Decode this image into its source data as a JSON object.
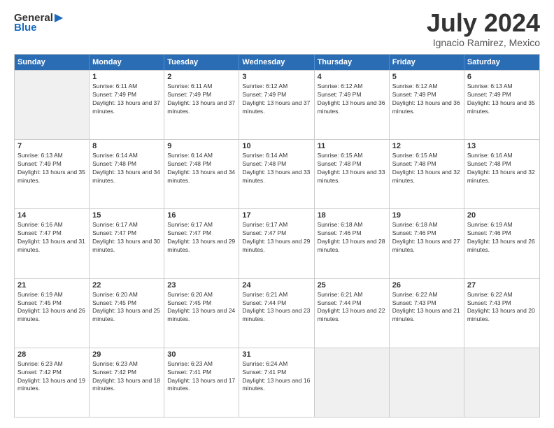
{
  "header": {
    "logo_general": "General",
    "logo_blue": "Blue",
    "title": "July 2024",
    "location": "Ignacio Ramirez, Mexico"
  },
  "calendar": {
    "weekdays": [
      "Sunday",
      "Monday",
      "Tuesday",
      "Wednesday",
      "Thursday",
      "Friday",
      "Saturday"
    ],
    "weeks": [
      [
        {
          "day": "",
          "sunrise": "",
          "sunset": "",
          "daylight": ""
        },
        {
          "day": "1",
          "sunrise": "Sunrise: 6:11 AM",
          "sunset": "Sunset: 7:49 PM",
          "daylight": "Daylight: 13 hours and 37 minutes."
        },
        {
          "day": "2",
          "sunrise": "Sunrise: 6:11 AM",
          "sunset": "Sunset: 7:49 PM",
          "daylight": "Daylight: 13 hours and 37 minutes."
        },
        {
          "day": "3",
          "sunrise": "Sunrise: 6:12 AM",
          "sunset": "Sunset: 7:49 PM",
          "daylight": "Daylight: 13 hours and 37 minutes."
        },
        {
          "day": "4",
          "sunrise": "Sunrise: 6:12 AM",
          "sunset": "Sunset: 7:49 PM",
          "daylight": "Daylight: 13 hours and 36 minutes."
        },
        {
          "day": "5",
          "sunrise": "Sunrise: 6:12 AM",
          "sunset": "Sunset: 7:49 PM",
          "daylight": "Daylight: 13 hours and 36 minutes."
        },
        {
          "day": "6",
          "sunrise": "Sunrise: 6:13 AM",
          "sunset": "Sunset: 7:49 PM",
          "daylight": "Daylight: 13 hours and 35 minutes."
        }
      ],
      [
        {
          "day": "7",
          "sunrise": "Sunrise: 6:13 AM",
          "sunset": "Sunset: 7:49 PM",
          "daylight": "Daylight: 13 hours and 35 minutes."
        },
        {
          "day": "8",
          "sunrise": "Sunrise: 6:14 AM",
          "sunset": "Sunset: 7:48 PM",
          "daylight": "Daylight: 13 hours and 34 minutes."
        },
        {
          "day": "9",
          "sunrise": "Sunrise: 6:14 AM",
          "sunset": "Sunset: 7:48 PM",
          "daylight": "Daylight: 13 hours and 34 minutes."
        },
        {
          "day": "10",
          "sunrise": "Sunrise: 6:14 AM",
          "sunset": "Sunset: 7:48 PM",
          "daylight": "Daylight: 13 hours and 33 minutes."
        },
        {
          "day": "11",
          "sunrise": "Sunrise: 6:15 AM",
          "sunset": "Sunset: 7:48 PM",
          "daylight": "Daylight: 13 hours and 33 minutes."
        },
        {
          "day": "12",
          "sunrise": "Sunrise: 6:15 AM",
          "sunset": "Sunset: 7:48 PM",
          "daylight": "Daylight: 13 hours and 32 minutes."
        },
        {
          "day": "13",
          "sunrise": "Sunrise: 6:16 AM",
          "sunset": "Sunset: 7:48 PM",
          "daylight": "Daylight: 13 hours and 32 minutes."
        }
      ],
      [
        {
          "day": "14",
          "sunrise": "Sunrise: 6:16 AM",
          "sunset": "Sunset: 7:47 PM",
          "daylight": "Daylight: 13 hours and 31 minutes."
        },
        {
          "day": "15",
          "sunrise": "Sunrise: 6:17 AM",
          "sunset": "Sunset: 7:47 PM",
          "daylight": "Daylight: 13 hours and 30 minutes."
        },
        {
          "day": "16",
          "sunrise": "Sunrise: 6:17 AM",
          "sunset": "Sunset: 7:47 PM",
          "daylight": "Daylight: 13 hours and 29 minutes."
        },
        {
          "day": "17",
          "sunrise": "Sunrise: 6:17 AM",
          "sunset": "Sunset: 7:47 PM",
          "daylight": "Daylight: 13 hours and 29 minutes."
        },
        {
          "day": "18",
          "sunrise": "Sunrise: 6:18 AM",
          "sunset": "Sunset: 7:46 PM",
          "daylight": "Daylight: 13 hours and 28 minutes."
        },
        {
          "day": "19",
          "sunrise": "Sunrise: 6:18 AM",
          "sunset": "Sunset: 7:46 PM",
          "daylight": "Daylight: 13 hours and 27 minutes."
        },
        {
          "day": "20",
          "sunrise": "Sunrise: 6:19 AM",
          "sunset": "Sunset: 7:46 PM",
          "daylight": "Daylight: 13 hours and 26 minutes."
        }
      ],
      [
        {
          "day": "21",
          "sunrise": "Sunrise: 6:19 AM",
          "sunset": "Sunset: 7:45 PM",
          "daylight": "Daylight: 13 hours and 26 minutes."
        },
        {
          "day": "22",
          "sunrise": "Sunrise: 6:20 AM",
          "sunset": "Sunset: 7:45 PM",
          "daylight": "Daylight: 13 hours and 25 minutes."
        },
        {
          "day": "23",
          "sunrise": "Sunrise: 6:20 AM",
          "sunset": "Sunset: 7:45 PM",
          "daylight": "Daylight: 13 hours and 24 minutes."
        },
        {
          "day": "24",
          "sunrise": "Sunrise: 6:21 AM",
          "sunset": "Sunset: 7:44 PM",
          "daylight": "Daylight: 13 hours and 23 minutes."
        },
        {
          "day": "25",
          "sunrise": "Sunrise: 6:21 AM",
          "sunset": "Sunset: 7:44 PM",
          "daylight": "Daylight: 13 hours and 22 minutes."
        },
        {
          "day": "26",
          "sunrise": "Sunrise: 6:22 AM",
          "sunset": "Sunset: 7:43 PM",
          "daylight": "Daylight: 13 hours and 21 minutes."
        },
        {
          "day": "27",
          "sunrise": "Sunrise: 6:22 AM",
          "sunset": "Sunset: 7:43 PM",
          "daylight": "Daylight: 13 hours and 20 minutes."
        }
      ],
      [
        {
          "day": "28",
          "sunrise": "Sunrise: 6:23 AM",
          "sunset": "Sunset: 7:42 PM",
          "daylight": "Daylight: 13 hours and 19 minutes."
        },
        {
          "day": "29",
          "sunrise": "Sunrise: 6:23 AM",
          "sunset": "Sunset: 7:42 PM",
          "daylight": "Daylight: 13 hours and 18 minutes."
        },
        {
          "day": "30",
          "sunrise": "Sunrise: 6:23 AM",
          "sunset": "Sunset: 7:41 PM",
          "daylight": "Daylight: 13 hours and 17 minutes."
        },
        {
          "day": "31",
          "sunrise": "Sunrise: 6:24 AM",
          "sunset": "Sunset: 7:41 PM",
          "daylight": "Daylight: 13 hours and 16 minutes."
        },
        {
          "day": "",
          "sunrise": "",
          "sunset": "",
          "daylight": ""
        },
        {
          "day": "",
          "sunrise": "",
          "sunset": "",
          "daylight": ""
        },
        {
          "day": "",
          "sunrise": "",
          "sunset": "",
          "daylight": ""
        }
      ]
    ]
  }
}
